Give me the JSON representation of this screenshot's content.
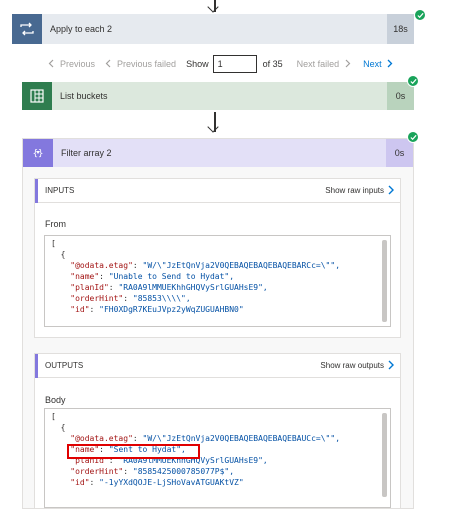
{
  "loop": {
    "title": "Apply to each 2",
    "duration": "18s"
  },
  "pager": {
    "previous": "Previous",
    "previous_failed": "Previous failed",
    "show": "Show",
    "page_value": "1",
    "of_total": "of 35",
    "next_failed": "Next failed",
    "next": "Next"
  },
  "list_buckets": {
    "title": "List buckets",
    "duration": "0s"
  },
  "filter": {
    "title": "Filter array 2",
    "duration": "0s"
  },
  "inputs": {
    "title": "INPUTS",
    "raw_link": "Show raw inputs",
    "field_label": "From",
    "lines": [
      "[",
      "  {",
      "    \"@odata.etag\": \"W/\\\"JzEtQnVja2V0QEBAQEBAQEBAQEBARCc=\\\"\",",
      "    \"name\": \"Unable to Send to Hydat\",",
      "    \"planId\": \"RA0A9lMMUEKhhGHQVySrlGUAHsE9\",",
      "    \"orderHint\": \"85853\\\\\\\\\",",
      "    \"id\": \"FH0XDgR7KEuJVpz2yWqZUGUAHBN0\""
    ]
  },
  "outputs": {
    "title": "OUTPUTS",
    "raw_link": "Show raw outputs",
    "field_label": "Body",
    "lines": [
      "[",
      "  {",
      "    \"@odata.etag\": \"W/\\\"JzEtQnVja2V0QEBAQEBAQEBAQEBAUCc=\\\"\",",
      "    \"name\": \"Sent to Hydat\",",
      "    \"planId\": \"RA0A9lMMUEKhhGHQVySrlGUAHsE9\",",
      "    \"orderHint\": \"8585425000785077P$\",",
      "    \"id\": \"-1yYXdQOJE-LjSHoVavATGUAKtVZ\""
    ]
  },
  "colors": {
    "loop_blue": "#486991",
    "loop_bg": "#e6eaef",
    "green": "#2f7d4f",
    "green_light": "#dce8dd",
    "purple": "#8378de",
    "purple_light": "#e3e0f7",
    "success": "#19a35a",
    "link": "#0078d4",
    "highlight": "#e00000"
  },
  "icons": [
    "loop-icon",
    "grid-icon",
    "filter-icon",
    "checkmark-icon",
    "chevron-left-icon",
    "chevron-right-icon",
    "arrow-down-icon"
  ]
}
